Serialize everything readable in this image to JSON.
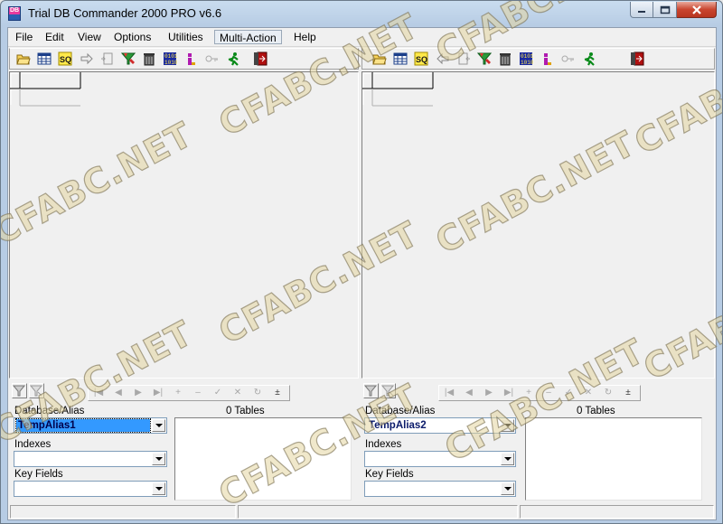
{
  "window": {
    "title": "Trial DB Commander 2000 PRO v6.6",
    "icon_text": "DB"
  },
  "menu": [
    "File",
    "Edit",
    "View",
    "Options",
    "Utilities",
    "Multi-Action",
    "Help"
  ],
  "active_menu": "Multi-Action",
  "toolbar_icons": [
    "open-folder-icon",
    "table-icon",
    "sql-icon",
    "arrow-icon",
    "document-icon",
    "filter-icon",
    "trash-icon",
    "binary-icon",
    "index-icon",
    "key-icon",
    "run-icon",
    "exit-icon"
  ],
  "left_panel": {
    "tables_caption": "0 Tables",
    "database_label": "Database/Alias",
    "database_value": "TempAlias1",
    "indexes_label": "Indexes",
    "key_fields_label": "Key Fields"
  },
  "right_panel": {
    "tables_caption": "0 Tables",
    "database_label": "Database/Alias",
    "database_value": "TempAlias2",
    "indexes_label": "Indexes",
    "key_fields_label": "Key Fields"
  },
  "watermark": "CFABC.NET",
  "colors": {
    "selection": "#3399ff",
    "title_bg": "#b7cce4",
    "close_btn": "#c9452f"
  }
}
